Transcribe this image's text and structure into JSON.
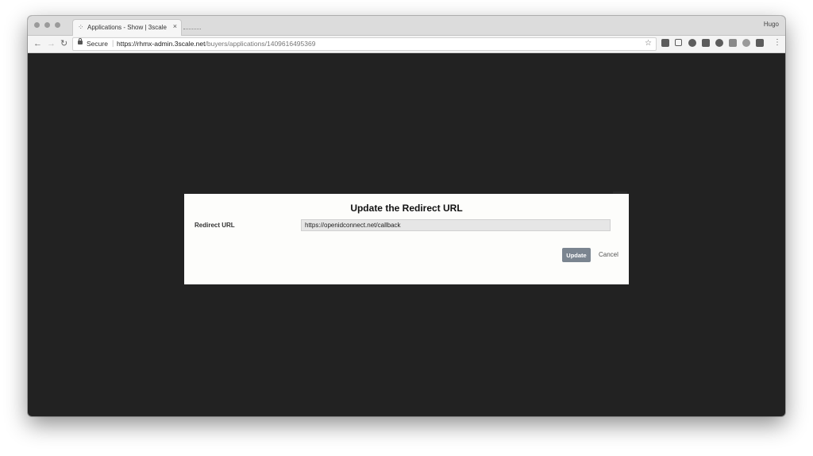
{
  "browser": {
    "tab_title": "Applications - Show | 3scale",
    "profile_name": "Hugo",
    "secure_label": "Secure",
    "url_host": "https://rhmx-admin.3scale.net",
    "url_path": "/buyers/applications/1409616495369"
  },
  "modal": {
    "title": "Update the Redirect URL",
    "field_label": "Redirect URL",
    "field_value": "https://openidconnect.net/callback",
    "update_label": "Update",
    "cancel_label": "Cancel"
  },
  "colors": {
    "page_background": "#222222",
    "update_button": "#7b8590"
  }
}
